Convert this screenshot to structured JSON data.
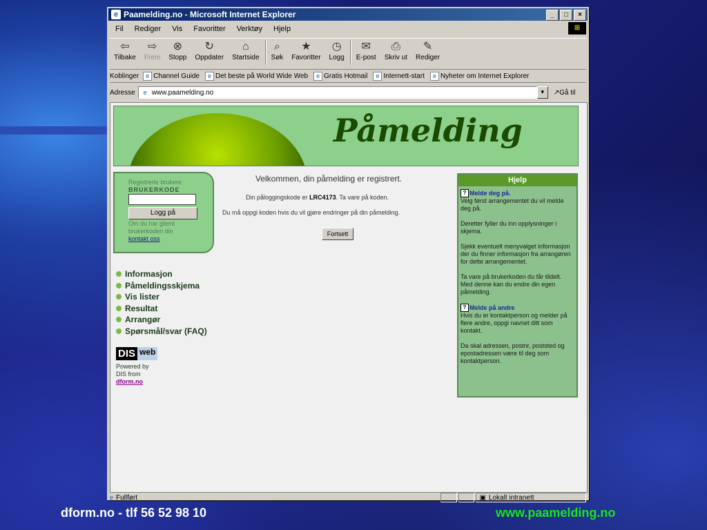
{
  "window": {
    "title": "Paamelding.no - Microsoft Internet Explorer",
    "controls": [
      "_",
      "□",
      "×"
    ]
  },
  "menu": [
    "Fil",
    "Rediger",
    "Vis",
    "Favoritter",
    "Verktøy",
    "Hjelp"
  ],
  "toolbar": {
    "back": "Tilbake",
    "forward": "Frem",
    "stop": "Stopp",
    "refresh": "Oppdater",
    "home": "Startside",
    "search": "Søk",
    "favorites": "Favoritter",
    "history": "Logg",
    "mail": "E-post",
    "print": "Skriv ut",
    "edit": "Rediger"
  },
  "links": {
    "label": "Koblinger",
    "items": [
      "Channel Guide",
      "Det beste på World Wide Web",
      "Gratis Hotmail",
      "Internett-start",
      "Nyheter om Internet Explorer"
    ]
  },
  "address": {
    "label": "Adresse",
    "value": "www.paamelding.no",
    "go": "Gå til"
  },
  "page": {
    "banner_title": "Påmelding",
    "login": {
      "label": "Registrerte brukere:",
      "code_label": "BRUKERKODE",
      "button": "Logg på",
      "forgot": "Om du har glemt brukerkoden din",
      "contact": "kontakt oss"
    },
    "welcome": "Velkommen, din påmelding er registrert.",
    "code_line_prefix": "Din påloggingskode er ",
    "code": "LRC4173",
    "code_line_suffix": ". Ta vare på koden.",
    "change_line": "Du må oppgi koden hvis du vil gjøre endringer på din påmelding.",
    "continue": "Fortsett",
    "nav": [
      "Informasjon",
      "Påmeldingsskjema",
      "Vis lister",
      "Resultat",
      "Arrangør",
      "Spørsmål/svar (FAQ)"
    ],
    "dis": {
      "logo_dis": "DIS",
      "logo_web": "web",
      "powered1": "Powered by",
      "powered2": "DIS from",
      "dform": "dform.no"
    },
    "help": {
      "title": "Hjelp",
      "head1": "Melde deg på.",
      "p1": "Velg først arrangementet du vil melde deg på.",
      "p2": "Deretter fyller du inn opplysninger i skjema.",
      "p3": "Sjekk eventuelt menyvalget informasjon der du finner informasjon fra arrangøren for dette arrangementet.",
      "p4": "Ta vare på brukerkoden du får tildelt. Med denne kan du endre din egen påmelding.",
      "head2": "Melde på andre",
      "p5": "Hvis du er kontaktperson og melder på flere andre, oppgi navnet ditt som kontakt.",
      "p6": "Da skal adressen, postnr, poststed og epostadressen være til deg som kontaktperson."
    }
  },
  "status": {
    "left": "Fullført",
    "right": "Lokalt intranett"
  },
  "slide": {
    "footer_left": "dform.no - tlf  56 52 98 10",
    "footer_right": "www.paamelding.no"
  }
}
